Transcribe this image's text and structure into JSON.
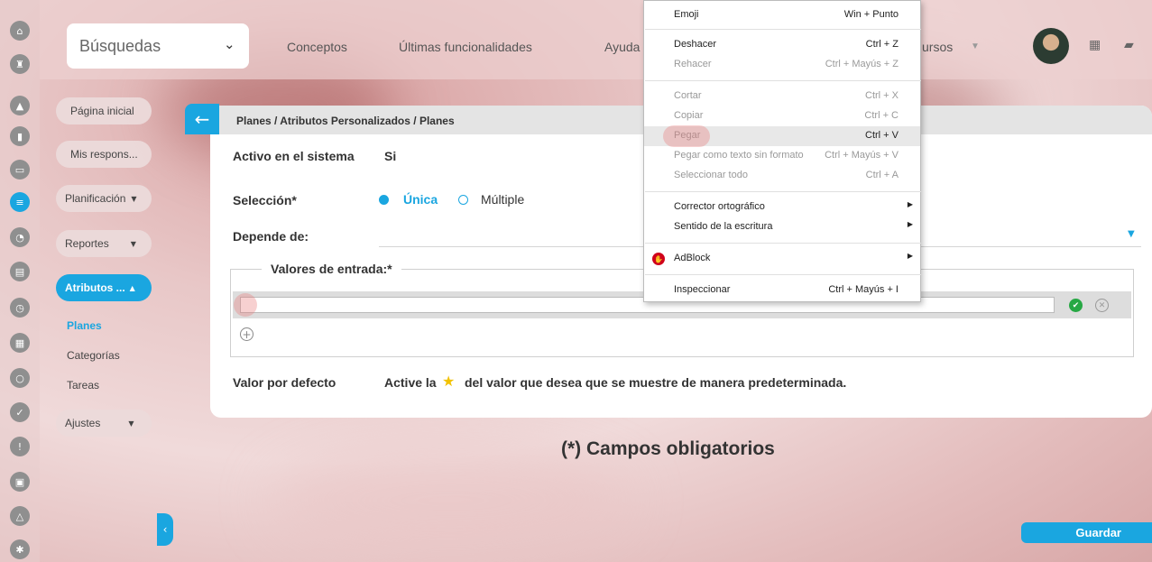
{
  "topbar": {
    "search_label": "Búsquedas",
    "nav": [
      "Conceptos",
      "Últimas funcionalidades",
      "Ayuda",
      "ursos"
    ]
  },
  "rail_icons": [
    "home-icon",
    "tower-icon",
    "triangle-icon",
    "chart-icon",
    "presentation-icon",
    "plans-icon",
    "pie-icon",
    "folder-icon",
    "clock-icon",
    "document-icon",
    "cycle-icon",
    "check-icon",
    "warning-icon",
    "calendar-icon",
    "network-icon",
    "settings-icon"
  ],
  "menu": {
    "pagina_inicial": "Página inicial",
    "mis_respons": "Mis respons...",
    "planificacion": "Planificación",
    "reportes": "Reportes",
    "atributos": "Atributos ...",
    "sub_planes": "Planes",
    "sub_categorias": "Categorías",
    "sub_tareas": "Tareas",
    "ajustes": "Ajustes"
  },
  "breadcrumb": "Planes / Atributos Personalizados / Planes",
  "form": {
    "activo_label": "Activo en el sistema",
    "activo_value": "Si",
    "seleccion_label": "Selección*",
    "option_unica": "Única",
    "option_multiple": "Múltiple",
    "depende_label": "Depende de:",
    "valores_label": "Valores de entrada:*",
    "input_value": "",
    "valor_defecto_label": "Valor por defecto",
    "valor_defecto_text_a": "Active la",
    "valor_defecto_text_b": "del valor que desea que se muestre de manera predeterminada."
  },
  "campos_obligatorios": "(*) Campos obligatorios",
  "guardar_label": "Guardar",
  "context_menu": {
    "emoji": "Emoji",
    "emoji_sc": "Win + Punto",
    "deshacer": "Deshacer",
    "deshacer_sc": "Ctrl + Z",
    "rehacer": "Rehacer",
    "rehacer_sc": "Ctrl + Mayús + Z",
    "cortar": "Cortar",
    "cortar_sc": "Ctrl + X",
    "copiar": "Copiar",
    "copiar_sc": "Ctrl + C",
    "pegar": "Pegar",
    "pegar_sc": "Ctrl + V",
    "pegar_sin": "Pegar como texto sin formato",
    "pegar_sin_sc": "Ctrl + Mayús + V",
    "seleccionar": "Seleccionar todo",
    "seleccionar_sc": "Ctrl + A",
    "corrector": "Corrector ortográfico",
    "sentido": "Sentido de la escritura",
    "adblock": "AdBlock",
    "inspeccionar": "Inspeccionar",
    "inspeccionar_sc": "Ctrl + Mayús + I"
  },
  "colors": {
    "accent": "#1aa6e0",
    "ok": "#27a844",
    "star": "#f2c200"
  }
}
